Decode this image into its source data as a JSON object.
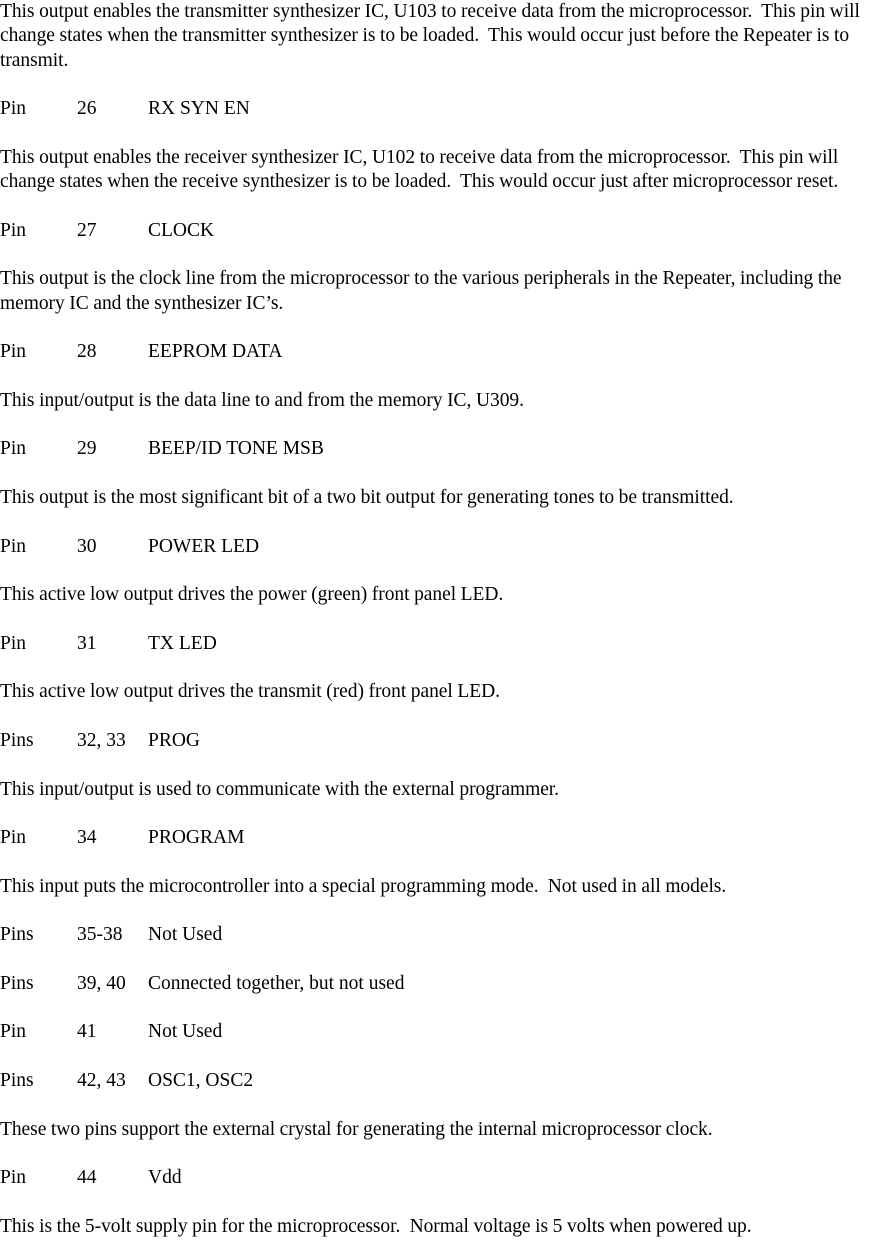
{
  "document": {
    "type": "technical-manual-page",
    "subject": "Repeater microprocessor pin descriptions",
    "background_color": "#ffffff",
    "text_color": "#000000"
  },
  "blocks": [
    {
      "kind": "paragraph",
      "text": "This output enables the transmitter synthesizer IC, U103 to receive data from the microprocessor.  This pin will change states when the transmitter synthesizer is to be loaded.  This would occur just before the Repeater is to transmit."
    },
    {
      "kind": "pin",
      "col_kind": "Pin",
      "col_num": "26",
      "col_label": "RX SYN EN"
    },
    {
      "kind": "paragraph",
      "text": "This output enables the receiver synthesizer IC, U102 to receive data from the microprocessor.  This pin will change states when the receive synthesizer is to be loaded.  This would occur just after microprocessor reset."
    },
    {
      "kind": "pin",
      "col_kind": "Pin",
      "col_num": "27",
      "col_label": "CLOCK"
    },
    {
      "kind": "paragraph",
      "text": "This output is the clock line from the microprocessor to the various peripherals in the Repeater, including the memory IC and the synthesizer IC’s."
    },
    {
      "kind": "pin",
      "col_kind": "Pin",
      "col_num": "28",
      "col_label": "EEPROM DATA"
    },
    {
      "kind": "paragraph",
      "text": "This input/output is the data line to and from the memory IC, U309."
    },
    {
      "kind": "pin",
      "col_kind": "Pin",
      "col_num": "29",
      "col_label": "BEEP/ID TONE MSB"
    },
    {
      "kind": "paragraph",
      "text": "This output is the most significant bit of a two bit output for generating tones to be transmitted."
    },
    {
      "kind": "pin",
      "col_kind": "Pin",
      "col_num": "30",
      "col_label": "POWER LED"
    },
    {
      "kind": "paragraph",
      "text": "This active low output drives the power (green) front panel LED."
    },
    {
      "kind": "pin",
      "col_kind": "Pin",
      "col_num": "31",
      "col_label": "TX LED"
    },
    {
      "kind": "paragraph",
      "text": "This active low output drives the transmit (red) front panel LED."
    },
    {
      "kind": "pin",
      "col_kind": "Pins",
      "col_num": "32, 33",
      "col_label": "PROG"
    },
    {
      "kind": "paragraph",
      "text": "This input/output is used to communicate with the external programmer."
    },
    {
      "kind": "pin",
      "col_kind": "Pin",
      "col_num": "34",
      "col_label": "PROGRAM"
    },
    {
      "kind": "paragraph",
      "text": "This input puts the microcontroller into a special programming mode.  Not used in all models."
    },
    {
      "kind": "pin",
      "col_kind": "Pins",
      "col_num": "35-38",
      "col_label": "Not Used"
    },
    {
      "kind": "pin",
      "col_kind": "Pins",
      "col_num": "39, 40",
      "col_label": "Connected together, but not used"
    },
    {
      "kind": "pin",
      "col_kind": "Pin",
      "col_num": "41",
      "col_label": "Not Used"
    },
    {
      "kind": "pin",
      "col_kind": "Pins",
      "col_num": "42, 43",
      "col_label": "OSC1, OSC2"
    },
    {
      "kind": "paragraph",
      "text": "These two pins support the external crystal for generating the internal microprocessor clock."
    },
    {
      "kind": "pin",
      "col_kind": "Pin",
      "col_num": "44",
      "col_label": "Vdd"
    },
    {
      "kind": "paragraph",
      "text": "This is the 5-volt supply pin for the microprocessor.  Normal voltage is 5 volts when powered up."
    }
  ]
}
